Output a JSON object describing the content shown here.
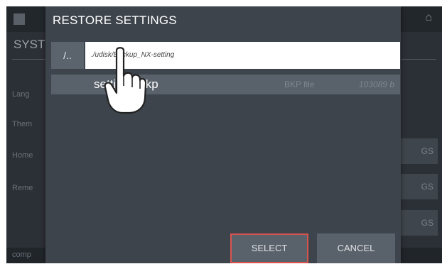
{
  "background": {
    "title": "SYST",
    "labels": [
      "Lang",
      "Them",
      "Home",
      "Reme"
    ],
    "buttons": [
      "GS",
      "GS",
      "GS"
    ],
    "footer": "comp"
  },
  "dialog": {
    "title": "RESTORE SETTINGS",
    "up_label": "/..",
    "path": "./udisk/Backup_NX-setting",
    "files": [
      {
        "name": "settings.bkp",
        "type": "BKP file",
        "size": "103089 b"
      }
    ],
    "select_label": "SELECT",
    "cancel_label": "CANCEL"
  },
  "colors": {
    "accent_border": "#d9534f",
    "dialog_bg": "#3d444c",
    "row_bg": "#59616a"
  }
}
